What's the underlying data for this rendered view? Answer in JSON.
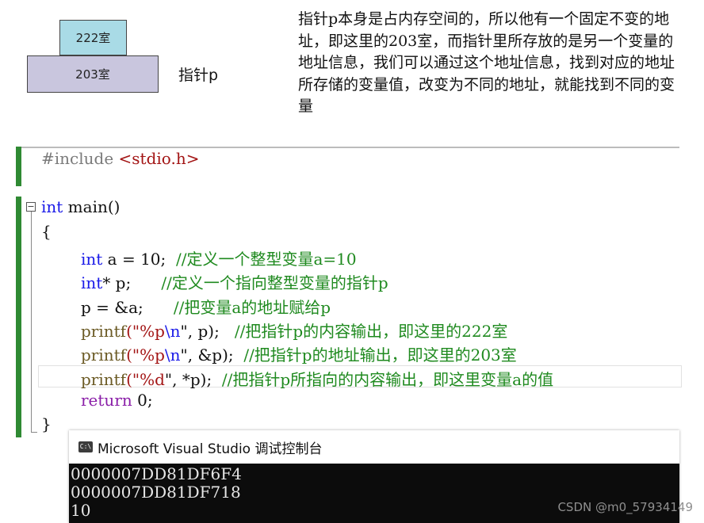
{
  "diagram": {
    "box_top": "222室",
    "box_bottom": "203室",
    "pointer_label": "指针p",
    "explanation": "指针p本身是占内存空间的，所以他有一个固定不变的地址，即这里的203室，而指针里所存放的是另一个变量的地址信息，我们可以通过这个地址信息，找到对应的地址所存储的变量值，改变为不同的地址，就能找到不同的变量"
  },
  "editor": {
    "fold_glyph": "−",
    "line1": {
      "pre": "#include",
      "inc": "<stdio.h>"
    },
    "line2": {
      "kw": "int",
      "rest": " main()"
    },
    "line3": "{",
    "line4": {
      "kw": "int",
      "code": " a = 10;  ",
      "comment": "//定义一个整型变量a=10"
    },
    "line5": {
      "kw": "int",
      "code": "* p;      ",
      "comment": "//定义一个指向整型变量的指针p"
    },
    "line6": {
      "code": "p = &a;      ",
      "comment": "//把变量a的地址赋给p"
    },
    "line7": {
      "fn": "printf",
      "open": "(\"",
      "fmt": "%p",
      "esc": "\\n",
      "close": "\", p);   ",
      "comment": "//把指针p的内容输出，即这里的222室"
    },
    "line8": {
      "fn": "printf",
      "open": "(\"",
      "fmt": "%p",
      "esc": "\\n",
      "close": "\", &p);  ",
      "comment": "//把指针p的地址输出，即这里的203室"
    },
    "line9": {
      "fn": "printf",
      "open": "(\"",
      "fmt": "%d",
      "close": "\", *p);  ",
      "comment": "//把指针p所指向的内容输出，即这里变量a的值"
    },
    "line10": {
      "kw": "return",
      "code": " 0;"
    },
    "line11": "}"
  },
  "console": {
    "icon_text": "C:\\",
    "title": "Microsoft Visual Studio 调试控制台",
    "output": [
      "0000007DD81DF6F4",
      "0000007DD81DF718",
      "10"
    ]
  },
  "watermark": "CSDN @m0_57934149",
  "colors": {
    "keyword": "#1a1ae8",
    "comment": "#1f8a1f",
    "string": "#a31515",
    "gutter_bar": "#2f8a33",
    "box_top_fill": "#a9dbe6",
    "box_bottom_fill": "#c9c6de",
    "console_bg": "#0c0c0c"
  }
}
